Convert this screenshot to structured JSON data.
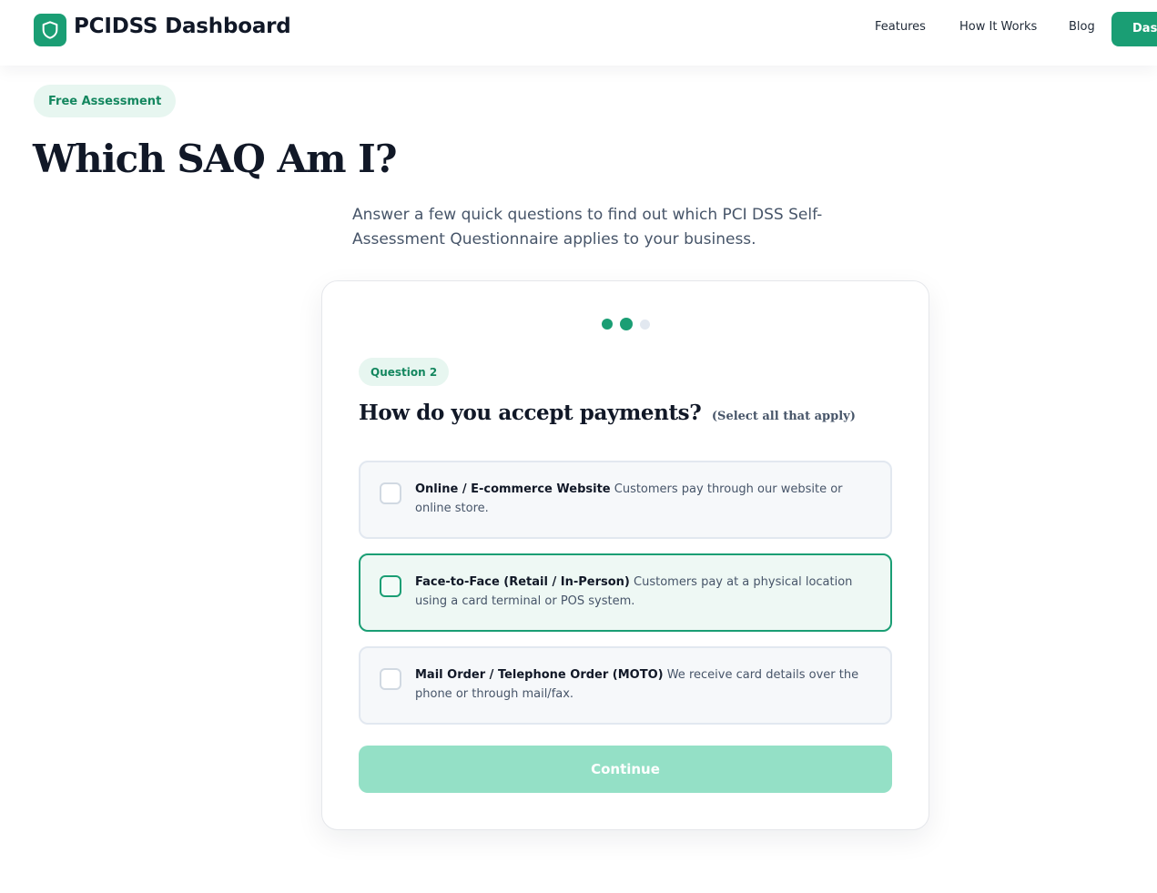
{
  "header": {
    "brand": "PCIDSS Dashboard",
    "logo_icon": "shield-icon",
    "nav": [
      "Features",
      "How It Works",
      "Blog"
    ],
    "cta_label": "Dashboard"
  },
  "hero": {
    "badge": "Free Assessment",
    "title": "Which SAQ Am I?",
    "subtitle": "Answer a few quick questions to find out which PCI DSS Self-Assessment Questionnaire applies to your business."
  },
  "quiz": {
    "current_step": 2,
    "total_steps": 3,
    "question_badge": "Question 2",
    "question": "How do you accept payments?",
    "hint": "(Select all that apply)",
    "options": [
      {
        "title": "Online / E-commerce Website",
        "description": "Customers pay through our website or online store.",
        "selected": false
      },
      {
        "title": "Face-to-Face (Retail / In-Person)",
        "description": "Customers pay at a physical location using a card terminal or POS system.",
        "selected": false,
        "focused": true
      },
      {
        "title": "Mail Order / Telephone Order (MOTO)",
        "description": "We receive card details over the phone or through mail/fax.",
        "selected": false
      }
    ],
    "continue_label": "Continue"
  },
  "colors": {
    "brand": "#1a9e74",
    "badge_bg": "#e7f6f0",
    "continue_disabled": "#94e0c6"
  }
}
